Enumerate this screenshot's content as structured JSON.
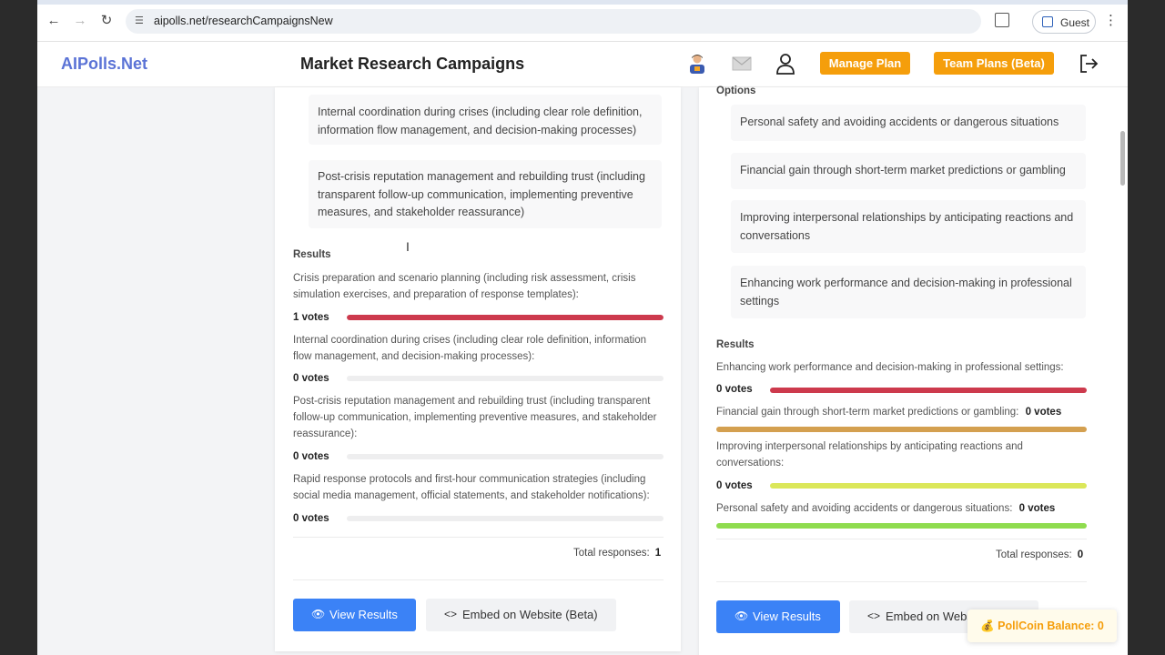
{
  "browser": {
    "url": "aipolls.net/researchCampaignsNew",
    "profile_label": "Guest"
  },
  "header": {
    "logo": "AIPolls.Net",
    "title": "Market Research Campaigns",
    "manage_plan": "Manage Plan",
    "team_plans": "Team Plans (Beta)"
  },
  "left_card": {
    "options": [
      "Internal coordination during crises (including clear role definition, information flow management, and decision-making processes)",
      "Post-crisis reputation management and rebuilding trust (including transparent follow-up communication, implementing preventive measures, and stakeholder reassurance)"
    ],
    "results_label": "Results",
    "results": [
      {
        "label": "Crisis preparation and scenario planning (including risk assessment, crisis simulation exercises, and preparation of response templates):",
        "votes": "1 votes",
        "fraction": 1.0
      },
      {
        "label": "Internal coordination during crises (including clear role definition, information flow management, and decision-making processes):",
        "votes": "0 votes",
        "fraction": 0
      },
      {
        "label": "Post-crisis reputation management and rebuilding trust (including transparent follow-up communication, implementing preventive measures, and stakeholder reassurance):",
        "votes": "0 votes",
        "fraction": 0
      },
      {
        "label": "Rapid response protocols and first-hour communication strategies (including social media management, official statements, and stakeholder notifications):",
        "votes": "0 votes",
        "fraction": 0
      }
    ],
    "total_label": "Total responses:",
    "total_value": "1",
    "view_results": "View Results",
    "embed": "Embed on Website (Beta)"
  },
  "right_card": {
    "options_label": "Options",
    "options": [
      "Personal safety and avoiding accidents or dangerous situations",
      "Financial gain through short-term market predictions or gambling",
      "Improving interpersonal relationships by anticipating reactions and conversations",
      "Enhancing work performance and decision-making in professional settings"
    ],
    "results_label": "Results",
    "results": [
      {
        "label": "Enhancing work performance and decision-making in professional settings:",
        "votes": "0 votes",
        "color": "#cd3a4d"
      },
      {
        "label": "Financial gain through short-term market predictions or gambling:",
        "votes": "0 votes",
        "color": "#d4a050"
      },
      {
        "label": "Improving interpersonal relationships by anticipating reactions and conversations:",
        "votes": "0 votes",
        "color": "#dbe75a"
      },
      {
        "label": "Personal safety and avoiding accidents or dangerous situations:",
        "votes": "0 votes",
        "color": "#8fdc4f"
      }
    ],
    "total_label": "Total responses:",
    "total_value": "0",
    "view_results": "View Results",
    "embed": "Embed on Webs"
  },
  "pollcoin": "💰 PollCoin Balance: 0",
  "colors": {
    "accent_blue": "#3b82f6",
    "accent_orange": "#f59e0b",
    "bar_red": "#cd3a4d",
    "logo": "#5b73d6"
  }
}
